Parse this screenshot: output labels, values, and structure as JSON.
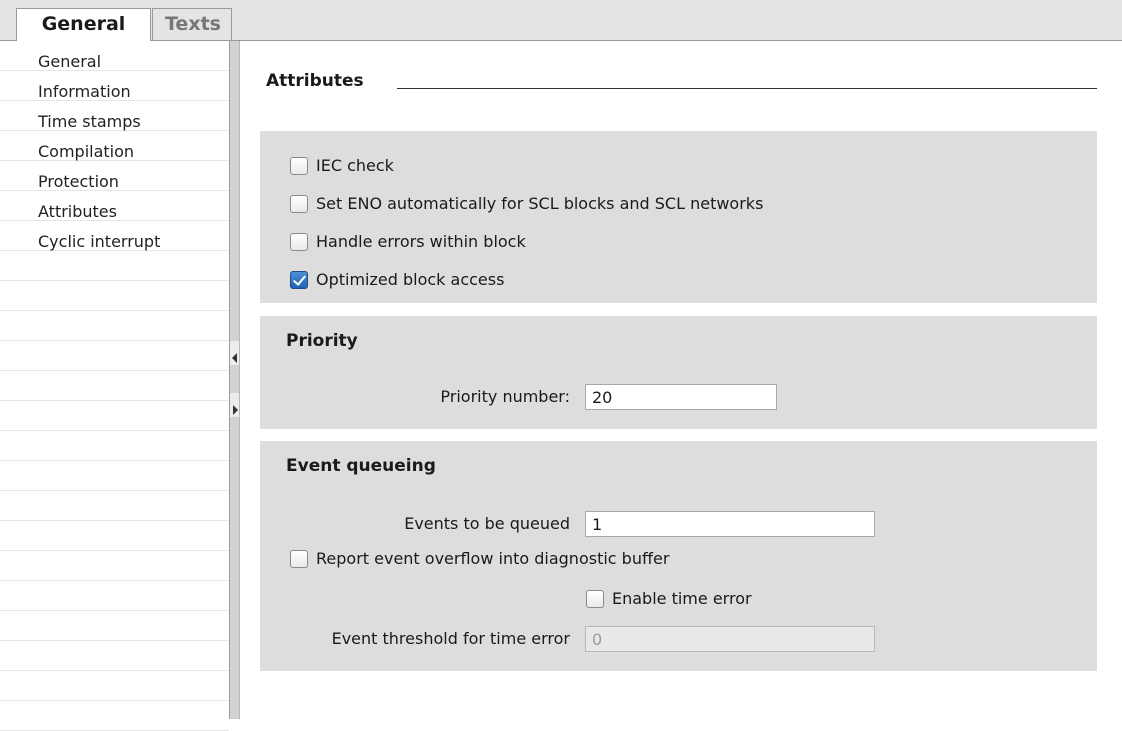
{
  "tabs": [
    {
      "label": "General",
      "active": true
    },
    {
      "label": "Texts",
      "active": false
    }
  ],
  "nav": {
    "items": [
      {
        "label": "General"
      },
      {
        "label": "Information"
      },
      {
        "label": "Time stamps"
      },
      {
        "label": "Compilation"
      },
      {
        "label": "Protection"
      },
      {
        "label": "Attributes",
        "selected": true
      },
      {
        "label": "Cyclic interrupt"
      }
    ]
  },
  "attributes": {
    "title": "Attributes",
    "checkboxes": [
      {
        "label": "IEC check",
        "checked": false
      },
      {
        "label": "Set ENO automatically for SCL blocks and SCL networks",
        "checked": false
      },
      {
        "label": "Handle errors within block",
        "checked": false
      },
      {
        "label": "Optimized block access",
        "checked": true
      }
    ]
  },
  "priority": {
    "title": "Priority",
    "number_label": "Priority number:",
    "number_value": "20"
  },
  "event_queueing": {
    "title": "Event queueing",
    "events_label": "Events to be queued",
    "events_value": "1",
    "report_overflow_label": "Report event overflow into diagnostic buffer",
    "report_overflow_checked": false,
    "enable_time_error_label": "Enable time error",
    "enable_time_error_checked": false,
    "threshold_label": "Event threshold for time error",
    "threshold_value": "0"
  },
  "colors": {
    "panel_bg": "#dddddd",
    "checkbox_checked": "#1f63b5",
    "tab_bar": "#e4e4e4"
  }
}
